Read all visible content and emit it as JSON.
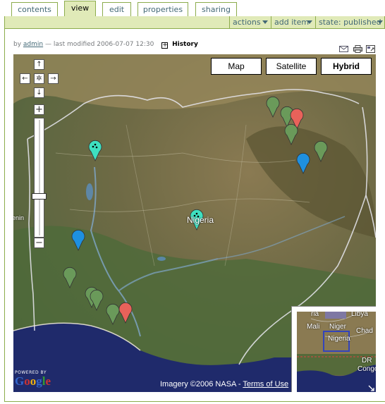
{
  "tabs": [
    {
      "label": "contents",
      "active": false
    },
    {
      "label": "view",
      "active": true
    },
    {
      "label": "edit",
      "active": false
    },
    {
      "label": "properties",
      "active": false
    },
    {
      "label": "sharing",
      "active": false
    }
  ],
  "actionbar": {
    "actions": "actions",
    "add_item": "add item",
    "state": "state: published"
  },
  "byline": {
    "prefix": "by",
    "author": "admin",
    "modified": "— last modified 2006-07-07 12:30",
    "history": "History",
    "history_toggle": "+"
  },
  "map": {
    "types": [
      {
        "label": "Map",
        "selected": false
      },
      {
        "label": "Satellite",
        "selected": false
      },
      {
        "label": "Hybrid",
        "selected": true
      }
    ],
    "place_label": "Nigeria",
    "edge_label": "enin",
    "powered_by": "POWERED BY",
    "logo_letters": [
      "G",
      "o",
      "o",
      "g",
      "l",
      "e"
    ],
    "logo_colors": [
      "#3366cc",
      "#cc3333",
      "#eeb211",
      "#3366cc",
      "#339933",
      "#cc3333"
    ],
    "imagery": "Imagery ©2006 NASA -",
    "terms": "Terms of Use",
    "overview_labels": {
      "libya": "Libya",
      "mali": "Mali",
      "niger": "Niger",
      "chad": "Chad",
      "nigeria": "Nigeria",
      "dr": "DR",
      "congo": "Congo",
      "algeria": "ria"
    },
    "markers": [
      {
        "color": "#6a9a5a",
        "kind": "green"
      },
      {
        "color": "#6a9a5a",
        "kind": "green"
      },
      {
        "color": "#e8625a",
        "kind": "red"
      },
      {
        "color": "#6a9a5a",
        "kind": "green"
      },
      {
        "color": "#6a9a5a",
        "kind": "green"
      },
      {
        "color": "#1e90e0",
        "kind": "blue"
      },
      {
        "color": "#3ee0c0",
        "kind": "cyan"
      },
      {
        "color": "#3ee0c0",
        "kind": "cyan"
      },
      {
        "color": "#1e90e0",
        "kind": "blue"
      },
      {
        "color": "#6a9a5a",
        "kind": "green"
      },
      {
        "color": "#6a9a5a",
        "kind": "green"
      },
      {
        "color": "#6a9a5a",
        "kind": "green"
      },
      {
        "color": "#e8625a",
        "kind": "red"
      },
      {
        "color": "#6a9a5a",
        "kind": "green"
      }
    ]
  },
  "colors": {
    "accent_green": "#8cac4c",
    "bar_fill": "#e0eab8",
    "link": "#436976"
  }
}
